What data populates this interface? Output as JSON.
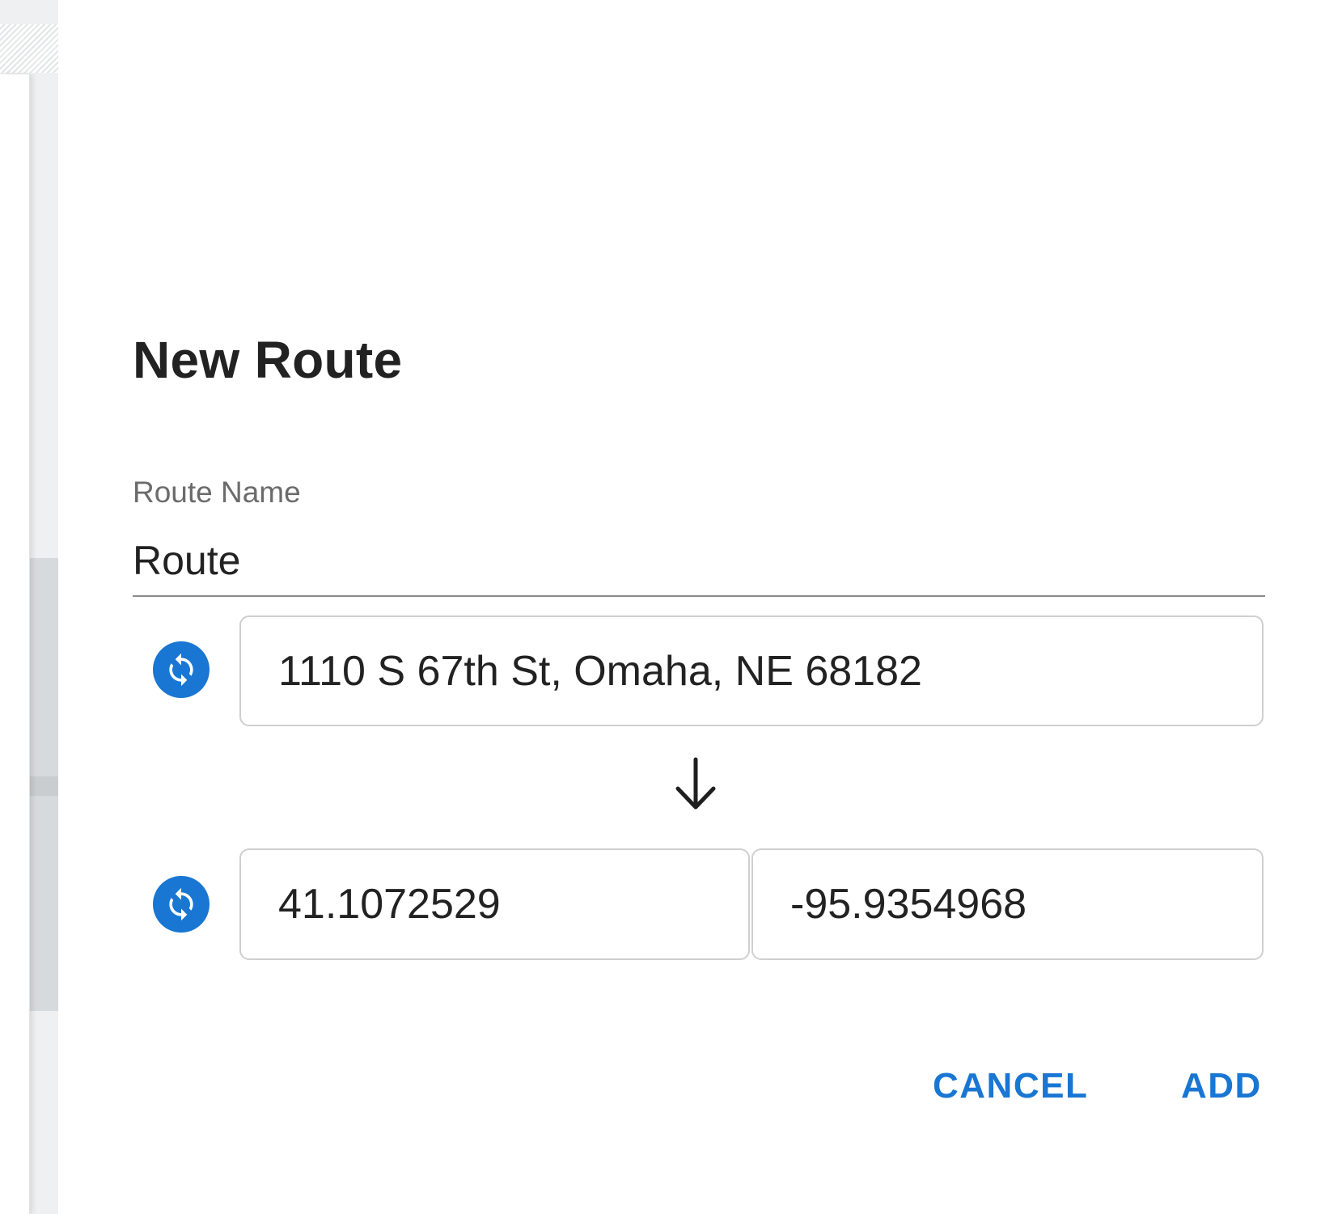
{
  "dialog": {
    "title": "New Route",
    "route_name_label": "Route Name",
    "route_name_value": "Route"
  },
  "origin": {
    "address_value": "1110 S 67th St, Omaha, NE 68182",
    "geo_icon": "sync-icon"
  },
  "destination": {
    "latitude_value": "41.1072529",
    "longitude_value": "-95.9354968",
    "geo_icon": "sync-icon"
  },
  "direction_icon": "arrow-down-icon",
  "actions": {
    "cancel_label": "CANCEL",
    "add_label": "ADD"
  },
  "colors": {
    "accent": "#1976d2",
    "text": "#222222",
    "label": "#6b6b6b",
    "border": "#cfcfcf"
  }
}
